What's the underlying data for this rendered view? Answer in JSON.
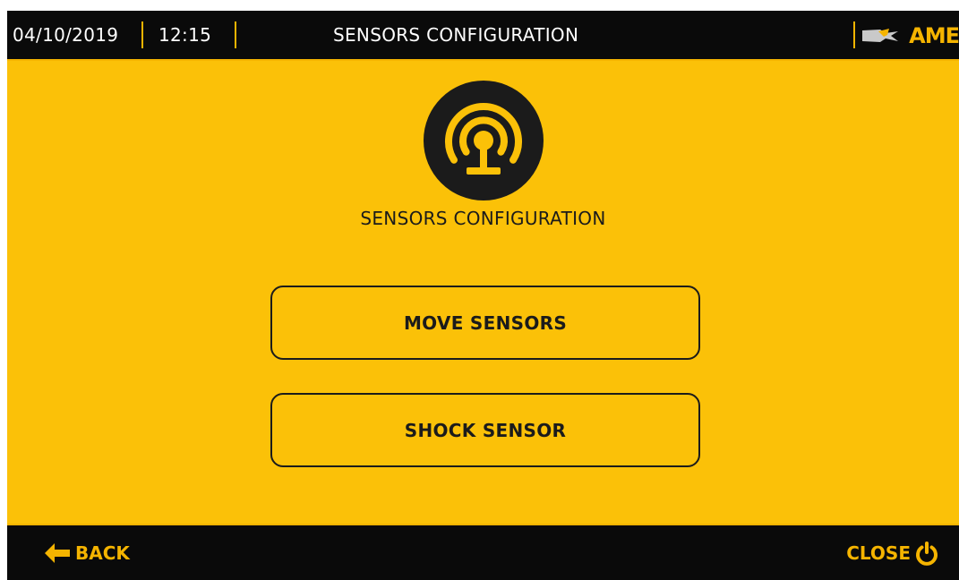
{
  "header": {
    "date": "04/10/2019",
    "time": "12:15",
    "title": "SENSORS CONFIGURATION",
    "logo_text": "AME"
  },
  "main": {
    "icon": "sensor-antenna-icon",
    "title": "SENSORS CONFIGURATION",
    "buttons": [
      {
        "label": "MOVE SENSORS"
      },
      {
        "label": "SHOCK SENSOR"
      }
    ]
  },
  "footer": {
    "back_label": "BACK",
    "back_icon": "arrow-left-icon",
    "close_label": "CLOSE",
    "close_icon": "power-icon"
  },
  "colors": {
    "background": "#fbc108",
    "bar": "#0a0a0a",
    "accent": "#f5b400",
    "ink": "#1b1b1b"
  }
}
